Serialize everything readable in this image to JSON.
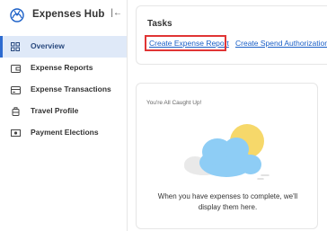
{
  "app": {
    "title": "Expenses Hub"
  },
  "sidebar": {
    "items": [
      {
        "label": "Overview",
        "icon": "grid-icon",
        "active": true
      },
      {
        "label": "Expense Reports",
        "icon": "wallet-icon",
        "active": false
      },
      {
        "label": "Expense Transactions",
        "icon": "card-icon",
        "active": false
      },
      {
        "label": "Travel Profile",
        "icon": "luggage-icon",
        "active": false
      },
      {
        "label": "Payment Elections",
        "icon": "money-icon",
        "active": false
      }
    ]
  },
  "tasks": {
    "title": "Tasks",
    "links": [
      {
        "label": "Create Expense Report"
      },
      {
        "label": "Create Spend Authorization"
      }
    ]
  },
  "status": {
    "heading": "You're All Caught Up!",
    "message_line1": "When you have expenses to complete, we'll",
    "message_line2": "display them here."
  },
  "colors": {
    "accent": "#2d6bd0",
    "link": "#1a5fc7",
    "active_bg": "#dfe9f8",
    "highlight": "#e03535"
  }
}
